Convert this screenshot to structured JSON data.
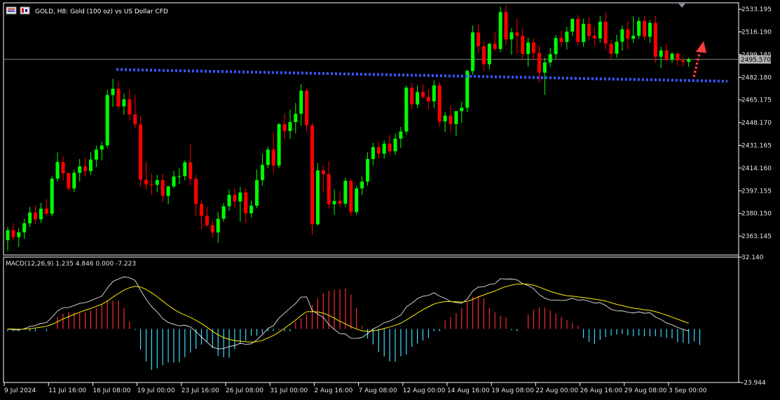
{
  "header": {
    "symbol_text": "GOLD, H8:  Gold (100 oz) vs US Dollar CFD"
  },
  "macd_label": "MACD(12,26,9) 1.235 4.846 0.000 -7.223",
  "colors": {
    "background": "#000000",
    "bull": "#00ff00",
    "bear": "#ff0000",
    "grid": "#ffffff",
    "dotted_line": "#3b56ff",
    "arrow": "#ff3b3b",
    "macd_pos": "#ff2a2a",
    "macd_neg": "#3fd8ff",
    "macd_line": "#ffffff",
    "signal_line": "#ffee00",
    "price_tag_bg": "#b0b0b0"
  },
  "chart_data": [
    {
      "type": "candlestick",
      "title": "",
      "price_axis_ticks": [
        "2533.195",
        "2516.190",
        "2499.185",
        "2482.180",
        "2465.175",
        "2448.170",
        "2431.165",
        "2414.160",
        "2397.155",
        "2380.150",
        "2363.145"
      ],
      "ylim": [
        2349.0,
        2538.0
      ],
      "current_price": "2495.570",
      "time_axis_labels": [
        "9 Jul 2024",
        "11 Jul 16:00",
        "16 Jul 08:00",
        "19 Jul 00:00",
        "23 Jul 16:00",
        "26 Jul 08:00",
        "31 Jul 00:00",
        "2 Aug 16:00",
        "7 Aug 08:00",
        "12 Aug 00:00",
        "14 Aug 16:00",
        "19 Aug 08:00",
        "22 Aug 00:00",
        "26 Aug 16:00",
        "29 Aug 08:00",
        "3 Sep 00:00"
      ],
      "candles": [
        [
          2360.1,
          2370.0,
          2352.0,
          2367.6
        ],
        [
          2367.6,
          2373.0,
          2360.0,
          2362.4
        ],
        [
          2362.4,
          2369.0,
          2355.0,
          2366.0
        ],
        [
          2366.0,
          2376.0,
          2361.0,
          2372.8
        ],
        [
          2372.8,
          2385.0,
          2370.0,
          2380.8
        ],
        [
          2380.8,
          2386.0,
          2372.0,
          2375.7
        ],
        [
          2375.7,
          2388.0,
          2373.0,
          2383.7
        ],
        [
          2383.7,
          2391.0,
          2378.0,
          2379.9
        ],
        [
          2379.9,
          2408.0,
          2378.0,
          2406.2
        ],
        [
          2406.2,
          2426.0,
          2404.0,
          2418.7
        ],
        [
          2418.7,
          2423.0,
          2405.0,
          2410.3
        ],
        [
          2410.3,
          2411.0,
          2397.0,
          2398.8
        ],
        [
          2398.8,
          2413.0,
          2396.0,
          2410.6
        ],
        [
          2410.6,
          2421.0,
          2404.0,
          2415.4
        ],
        [
          2415.4,
          2422.0,
          2408.0,
          2411.9
        ],
        [
          2411.9,
          2426.0,
          2409.0,
          2420.5
        ],
        [
          2420.5,
          2431.0,
          2415.0,
          2428.0
        ],
        [
          2428.0,
          2434.0,
          2420.0,
          2431.1
        ],
        [
          2431.1,
          2473.0,
          2429.0,
          2468.9
        ],
        [
          2468.9,
          2481.0,
          2460.0,
          2473.6
        ],
        [
          2473.6,
          2479.0,
          2458.0,
          2460.4
        ],
        [
          2460.4,
          2470.0,
          2454.0,
          2465.6
        ],
        [
          2465.6,
          2473.0,
          2450.0,
          2454.4
        ],
        [
          2454.4,
          2469.0,
          2444.0,
          2446.9
        ],
        [
          2446.9,
          2453.0,
          2400.0,
          2405.4
        ],
        [
          2405.4,
          2419.0,
          2398.0,
          2401.9
        ],
        [
          2401.9,
          2410.0,
          2394.0,
          2401.6
        ],
        [
          2401.6,
          2409.0,
          2396.0,
          2405.1
        ],
        [
          2405.1,
          2410.0,
          2389.0,
          2393.3
        ],
        [
          2393.3,
          2401.0,
          2387.0,
          2400.4
        ],
        [
          2400.4,
          2412.0,
          2399.0,
          2407.8
        ],
        [
          2407.8,
          2414.0,
          2402.0,
          2408.1
        ],
        [
          2408.1,
          2420.0,
          2405.0,
          2418.4
        ],
        [
          2418.4,
          2432.0,
          2401.0,
          2406.0
        ],
        [
          2406.0,
          2409.0,
          2378.0,
          2387.3
        ],
        [
          2387.3,
          2390.0,
          2368.0,
          2378.4
        ],
        [
          2378.4,
          2385.0,
          2370.0,
          2371.4
        ],
        [
          2371.4,
          2375.0,
          2362.0,
          2365.9
        ],
        [
          2365.9,
          2381.0,
          2358.0,
          2376.1
        ],
        [
          2376.1,
          2388.0,
          2374.0,
          2385.5
        ],
        [
          2385.5,
          2398.0,
          2382.0,
          2394.0
        ],
        [
          2394.0,
          2399.0,
          2384.0,
          2389.1
        ],
        [
          2389.1,
          2400.0,
          2374.0,
          2395.8
        ],
        [
          2395.8,
          2399.0,
          2373.0,
          2380.3
        ],
        [
          2380.3,
          2390.0,
          2377.0,
          2385.9
        ],
        [
          2385.9,
          2413.0,
          2384.0,
          2405.1
        ],
        [
          2405.1,
          2425.0,
          2401.0,
          2416.5
        ],
        [
          2416.5,
          2430.0,
          2414.0,
          2428.0
        ],
        [
          2428.0,
          2441.0,
          2410.0,
          2416.0
        ],
        [
          2416.0,
          2448.0,
          2414.0,
          2447.0
        ],
        [
          2447.0,
          2455.0,
          2436.0,
          2441.9
        ],
        [
          2441.9,
          2458.0,
          2436.0,
          2448.6
        ],
        [
          2448.6,
          2463.0,
          2440.0,
          2454.8
        ],
        [
          2454.8,
          2477.0,
          2446.0,
          2472.1
        ],
        [
          2472.1,
          2474.0,
          2441.0,
          2446.2
        ],
        [
          2446.2,
          2448.0,
          2364.0,
          2372.0
        ],
        [
          2372.0,
          2418.0,
          2371.0,
          2412.4
        ],
        [
          2412.4,
          2416.0,
          2396.0,
          2409.6
        ],
        [
          2409.6,
          2419.0,
          2384.0,
          2387.0
        ],
        [
          2387.0,
          2398.0,
          2379.0,
          2389.5
        ],
        [
          2389.5,
          2397.0,
          2385.0,
          2387.5
        ],
        [
          2387.5,
          2407.0,
          2385.0,
          2404.6
        ],
        [
          2404.6,
          2406.0,
          2378.0,
          2381.2
        ],
        [
          2381.2,
          2401.0,
          2379.0,
          2398.9
        ],
        [
          2398.9,
          2408.0,
          2394.0,
          2404.0
        ],
        [
          2404.0,
          2426.0,
          2401.0,
          2420.9
        ],
        [
          2420.9,
          2433.0,
          2416.0,
          2429.9
        ],
        [
          2429.9,
          2434.0,
          2421.0,
          2424.9
        ],
        [
          2424.9,
          2435.0,
          2421.0,
          2432.4
        ],
        [
          2432.4,
          2439.0,
          2424.0,
          2426.7
        ],
        [
          2426.7,
          2440.0,
          2424.0,
          2436.3
        ],
        [
          2436.3,
          2445.0,
          2429.0,
          2441.6
        ],
        [
          2441.6,
          2476.0,
          2439.0,
          2474.4
        ],
        [
          2474.4,
          2478.0,
          2458.0,
          2461.8
        ],
        [
          2461.8,
          2476.0,
          2459.0,
          2471.1
        ],
        [
          2471.1,
          2477.0,
          2466.0,
          2467.5
        ],
        [
          2467.5,
          2473.0,
          2458.0,
          2464.2
        ],
        [
          2464.2,
          2480.0,
          2459.0,
          2476.1
        ],
        [
          2476.1,
          2479.0,
          2445.0,
          2449.1
        ],
        [
          2449.1,
          2456.0,
          2441.0,
          2453.4
        ],
        [
          2453.4,
          2461.0,
          2441.0,
          2447.1
        ],
        [
          2447.1,
          2457.0,
          2438.0,
          2456.8
        ],
        [
          2456.8,
          2464.0,
          2448.0,
          2459.4
        ],
        [
          2459.4,
          2488.0,
          2456.0,
          2486.9
        ],
        [
          2486.9,
          2521.0,
          2484.0,
          2515.8
        ],
        [
          2515.8,
          2522.0,
          2500.0,
          2505.4
        ],
        [
          2505.4,
          2509.0,
          2487.0,
          2491.9
        ],
        [
          2491.9,
          2508.0,
          2488.0,
          2507.3
        ],
        [
          2507.3,
          2516.0,
          2502.0,
          2503.4
        ],
        [
          2503.4,
          2535.0,
          2501.0,
          2531.0
        ],
        [
          2531.0,
          2536.0,
          2506.0,
          2510.6
        ],
        [
          2510.6,
          2519.0,
          2499.0,
          2515.8
        ],
        [
          2515.8,
          2526.0,
          2500.0,
          2513.2
        ],
        [
          2513.2,
          2519.0,
          2496.0,
          2499.7
        ],
        [
          2499.7,
          2512.0,
          2490.0,
          2508.3
        ],
        [
          2508.3,
          2511.0,
          2496.0,
          2500.5
        ],
        [
          2500.5,
          2506.0,
          2478.0,
          2485.6
        ],
        [
          2485.6,
          2497.0,
          2469.0,
          2493.3
        ],
        [
          2493.3,
          2504.0,
          2490.0,
          2499.5
        ],
        [
          2499.5,
          2514.0,
          2496.0,
          2511.6
        ],
        [
          2511.6,
          2517.0,
          2505.0,
          2508.7
        ],
        [
          2508.7,
          2520.0,
          2503.0,
          2516.4
        ],
        [
          2516.4,
          2526.0,
          2513.0,
          2526.0
        ],
        [
          2526.0,
          2529.0,
          2506.0,
          2508.6
        ],
        [
          2508.6,
          2526.0,
          2505.0,
          2522.3
        ],
        [
          2522.3,
          2527.0,
          2510.0,
          2513.3
        ],
        [
          2513.3,
          2520.0,
          2506.0,
          2511.3
        ],
        [
          2511.3,
          2528.0,
          2508.0,
          2523.8
        ],
        [
          2523.8,
          2531.0,
          2503.0,
          2507.4
        ],
        [
          2507.4,
          2510.0,
          2496.0,
          2499.8
        ],
        [
          2499.8,
          2514.0,
          2497.0,
          2508.8
        ],
        [
          2508.8,
          2521.0,
          2502.0,
          2518.1
        ],
        [
          2518.1,
          2524.0,
          2503.0,
          2511.1
        ],
        [
          2511.1,
          2528.0,
          2508.0,
          2513.3
        ],
        [
          2513.3,
          2527.0,
          2511.0,
          2524.4
        ],
        [
          2524.4,
          2528.0,
          2510.0,
          2512.6
        ],
        [
          2512.6,
          2525.0,
          2508.0,
          2522.9
        ],
        [
          2522.9,
          2528.0,
          2493.0,
          2497.6
        ],
        [
          2497.6,
          2505.0,
          2489.0,
          2502.3
        ],
        [
          2502.3,
          2507.0,
          2494.0,
          2495.6
        ],
        [
          2495.6,
          2501.0,
          2493.0,
          2499.9
        ],
        [
          2499.9,
          2501.0,
          2491.0,
          2494.8
        ],
        [
          2494.8,
          2497.0,
          2490.0,
          2493.8
        ],
        [
          2493.8,
          2497.0,
          2490.0,
          2495.6
        ]
      ]
    },
    {
      "type": "macd",
      "title": "MACD(12,26,9) 1.235 4.846 0.000 -7.223",
      "ylim": [
        -23.944,
        32.14
      ],
      "axis_ticks": [
        "32.140",
        "-23.944"
      ],
      "histogram": [
        -1.02,
        -1.02,
        -1.03,
        0.0,
        -1.03,
        -1.02,
        0.0,
        -1.02,
        0.0,
        5.5,
        6.8,
        7.6,
        7.3,
        7.1,
        7.3,
        8.4,
        9.3,
        10.8,
        12.9,
        12.6,
        12.7,
        9.3,
        3.3,
        -0.4,
        -9.2,
        -14.5,
        -18.4,
        -17.6,
        -16.2,
        -14.9,
        -15.0,
        -14.9,
        -12.6,
        -10.6,
        -8.9,
        -7.0,
        -5.6,
        -8.5,
        -12.1,
        -12.7,
        -12.9,
        -9.0,
        -6.6,
        -5.3,
        -3.1,
        -3.0,
        -2.0,
        -1.0,
        -0.9,
        -0.4,
        -1.0,
        -1.0,
        2.9,
        4.7,
        6.6,
        10.7,
        13.7,
        16.0,
        17.1,
        17.5,
        17.8,
        18.1,
        15.4,
        9.4,
        1.4,
        -4.3,
        -6.9,
        -10.3,
        -12.3,
        -14.5,
        -14.6,
        -12.2,
        -11.4,
        -8.0,
        -6.6,
        -5.2,
        -4.0,
        -1.0,
        -1.0,
        3.8,
        5.3,
        7.1,
        9.4,
        11.7,
        14.4,
        14.7,
        13.8,
        9.5,
        7.4,
        5.9,
        5.2,
        -0.6,
        -1.0,
        0.0,
        6.4,
        8.5,
        9.7,
        9.5,
        8.3,
        6.8,
        5.4,
        3.9,
        2.8,
        1.4,
        -4.1,
        -5.8,
        -6.7,
        -4.9,
        -3.7,
        -3.0,
        -2.5,
        -2.3,
        -2.9,
        -3.3,
        -3.0,
        -3.3,
        -3.3,
        -3.2,
        -3.6,
        -4.0,
        -4.2,
        -5.9,
        -6.2,
        -6.6,
        -5.6,
        -7.2
      ]
    }
  ]
}
